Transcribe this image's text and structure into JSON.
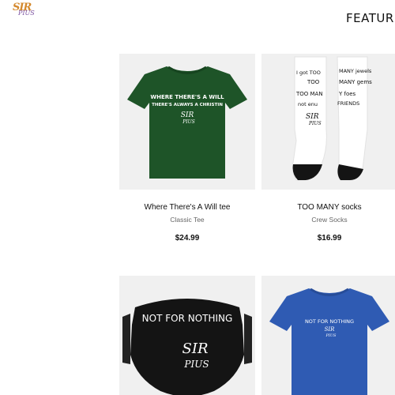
{
  "header": {
    "logo": {
      "line1": "SIR",
      "line2": "PIUS"
    },
    "section_title": "FEATURED"
  },
  "colors": {
    "green_tee": "#1e5428",
    "blue_tee": "#2f5bb3",
    "mask": "#141414",
    "card_bg": "#f0f0f0"
  },
  "products": [
    {
      "name": "Where There's A Will tee",
      "type": "Classic Tee",
      "price": "$24.99",
      "art": {
        "line1": "WHERE THERE'S A WILL",
        "line2": "THERE'S ALWAYS A CHRISTIN",
        "logo1": "SIR",
        "logo2": "PIUS"
      }
    },
    {
      "name": "TOO MANY socks",
      "type": "Crew Socks",
      "price": "$16.99",
      "art": {
        "l1": "I got TOO",
        "l2": "MANY jewels",
        "l3": "TOO",
        "l4": "MANY gems",
        "l5": "TOO MAN",
        "l6": "Y foes",
        "l7": "not enu",
        "l8": "FRIENDS",
        "logo1": "SIR",
        "logo2": "PIUS"
      }
    },
    {
      "name": "",
      "type": "",
      "price": "",
      "art": {
        "line1": "NOT FOR NOTHING",
        "logo1": "SIR",
        "logo2": "PIUS"
      }
    },
    {
      "name": "",
      "type": "",
      "price": "",
      "art": {
        "line1": "NOT FOR NOTHING",
        "logo1": "SIR",
        "logo2": "PIUS"
      }
    }
  ]
}
